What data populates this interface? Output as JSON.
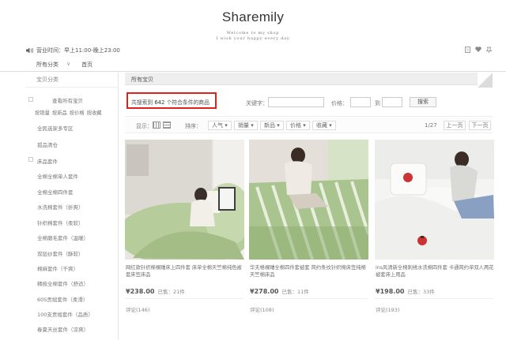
{
  "shop": {
    "name": "Sharemily",
    "tagline_1": "Welcome to my shop",
    "tagline_2": "I wish your happy every day"
  },
  "header": {
    "hours": "营业时间：早上11:00-晚上23:00",
    "icons": [
      "document-icon",
      "heart-icon",
      "pin-icon"
    ]
  },
  "nav": {
    "all_items": "所有分类",
    "chevron": "∨",
    "home": "首页"
  },
  "sidebar": {
    "title": "宝贝分类",
    "view_all": "查看所有宝贝",
    "sort_links": [
      "按销量",
      "按新品",
      "按价格",
      "按收藏"
    ],
    "items": [
      "全民选家多专区",
      "孤品清仓",
      "床品套件",
      "全棉全棉单人套件",
      "全棉全棉四件套",
      "水洗棉套件（折爽）",
      "针织棉套件（柔软）",
      "全棉磨毛套件（温暖）",
      "双层纱套件（酥软）",
      "棉麻套件（干爽）",
      "精梳全棉套件（舒适）",
      "60S贡缎套件（柔滑）",
      "100支贡缎套件（品质）",
      "春夏天丝套件（凉爽）"
    ]
  },
  "main": {
    "header_title": "所有宝贝",
    "result": {
      "prefix": "共搜索到",
      "count": "642",
      "suffix": "个符合条件的商品"
    },
    "filter": {
      "keyword_label": "关键字：",
      "price_label": "价格：",
      "to_label": "到",
      "search_button": "搜索"
    },
    "toolbar": {
      "display_label": "显示：",
      "sort_label": "排序：",
      "sort_options": [
        "人气",
        "销量",
        "新品",
        "价格",
        "收藏"
      ],
      "page_indicator": "1/27",
      "prev_page": "上一页",
      "next_page": "下一页"
    }
  },
  "products": [
    {
      "title": "网红款针织棉裸睡床上四件套 床单全棉天竺棉纯色被套床笠床品",
      "currency": "¥",
      "price": "238.00",
      "sold": "已售：21件",
      "reviews": "评论(146)"
    },
    {
      "title": "华夫格裸睡全棉四件套被套 简约条纹针织棉床笠纯棉天竺棉床品",
      "currency": "¥",
      "price": "278.00",
      "sold": "已售：11件",
      "reviews": "评论(108)"
    },
    {
      "title": "ins风清新全棉刺绣水洗棉四件套 卡通简约单双人两花被套床上用品",
      "currency": "¥",
      "price": "198.00",
      "sold": "已售：33件",
      "reviews": "评论(193)"
    }
  ],
  "colors": {
    "highlight_border": "#e0201a",
    "panel_header": "#eeeeee",
    "bedding_green": "#a9c48f"
  }
}
